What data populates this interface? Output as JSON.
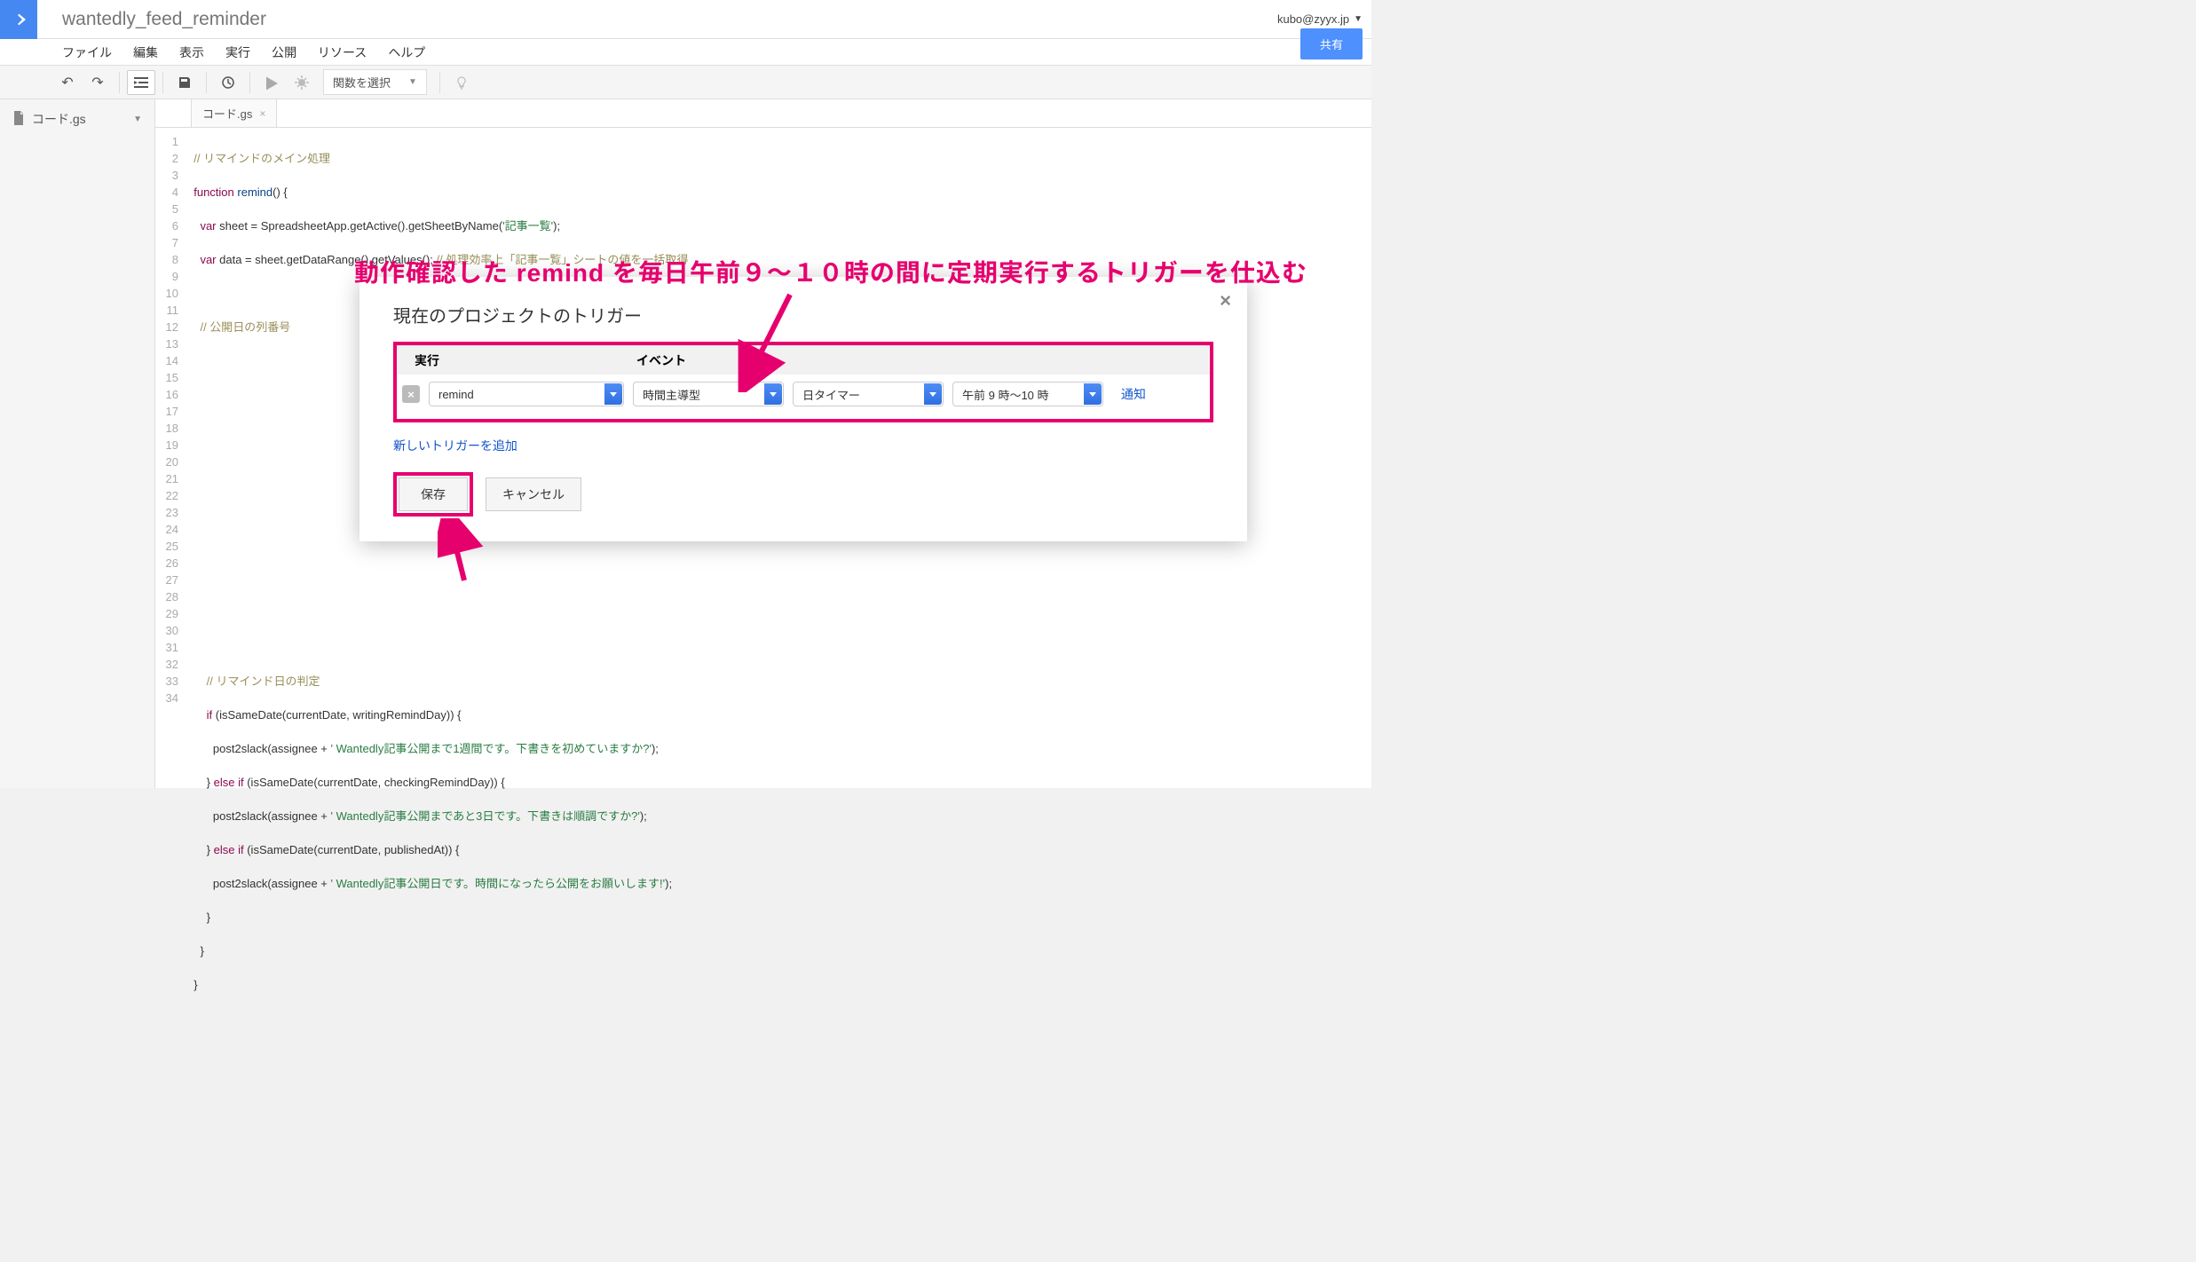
{
  "header": {
    "project_title": "wantedly_feed_reminder",
    "user_email": "kubo@zyyx.jp",
    "share_label": "共有"
  },
  "menu": {
    "file": "ファイル",
    "edit": "編集",
    "view": "表示",
    "run": "実行",
    "publish": "公開",
    "resources": "リソース",
    "help": "ヘルプ"
  },
  "toolbar": {
    "func_select": "関数を選択"
  },
  "sidebar": {
    "file_name": "コード.gs"
  },
  "tab": {
    "name": "コード.gs"
  },
  "code_lines": [
    1,
    2,
    3,
    4,
    5,
    6,
    7,
    8,
    9,
    10,
    11,
    12,
    13,
    14,
    15,
    16,
    17,
    18,
    19,
    20,
    21,
    22,
    23,
    24,
    25,
    26,
    27,
    28,
    29,
    30,
    31,
    32,
    33,
    34
  ],
  "code": {
    "l1_comment": "// リマインドのメイン処理",
    "l2a": "function",
    "l2b": " remind",
    "l2c": "() {",
    "l3a": "var",
    "l3b": " sheet = SpreadsheetApp.getActive().getSheetByName(",
    "l3c": "'記事一覧'",
    "l3d": ");",
    "l4a": "var",
    "l4b": " data = sheet.getDataRange().getValues(); ",
    "l4c": "// 処理効率上「記事一覧」シートの値を一括取得",
    "l6_comment": "// 公開日の列番号",
    "l25_comment": "// リマインド日の判定",
    "l26a": "if",
    "l26b": " (isSameDate(currentDate, writingRemindDay)) {",
    "l27a": "post2slack(assignee + ",
    "l27b": "' Wantedly記事公開まで1週間です。下書きを初めていますか?'",
    "l27c": ");",
    "l28a": "} ",
    "l28b": "else if",
    "l28c": " (isSameDate(currentDate, checkingRemindDay)) {",
    "l29a": "post2slack(assignee + ",
    "l29b": "' Wantedly記事公開まであと3日です。下書きは順調ですか?'",
    "l29c": ");",
    "l30a": "} ",
    "l30b": "else if",
    "l30c": " (isSameDate(currentDate, publishedAt)) {",
    "l31a": "post2slack(assignee + ",
    "l31b": "' Wantedly記事公開日です。時間になったら公開をお願いします!'",
    "l31c": ");",
    "l32": "}",
    "l33": "}",
    "l34": "}"
  },
  "annotation": "動作確認した remind を毎日午前９〜１０時の間に定期実行するトリガーを仕込む",
  "dialog": {
    "title": "現在のプロジェクトのトリガー",
    "hdr_run": "実行",
    "hdr_event": "イベント",
    "sel_run": "remind",
    "sel_ev1": "時間主導型",
    "sel_ev2": "日タイマー",
    "sel_ev3": "午前 9 時～10 時",
    "notification": "通知",
    "add_trigger": "新しいトリガーを追加",
    "save": "保存",
    "cancel": "キャンセル"
  }
}
